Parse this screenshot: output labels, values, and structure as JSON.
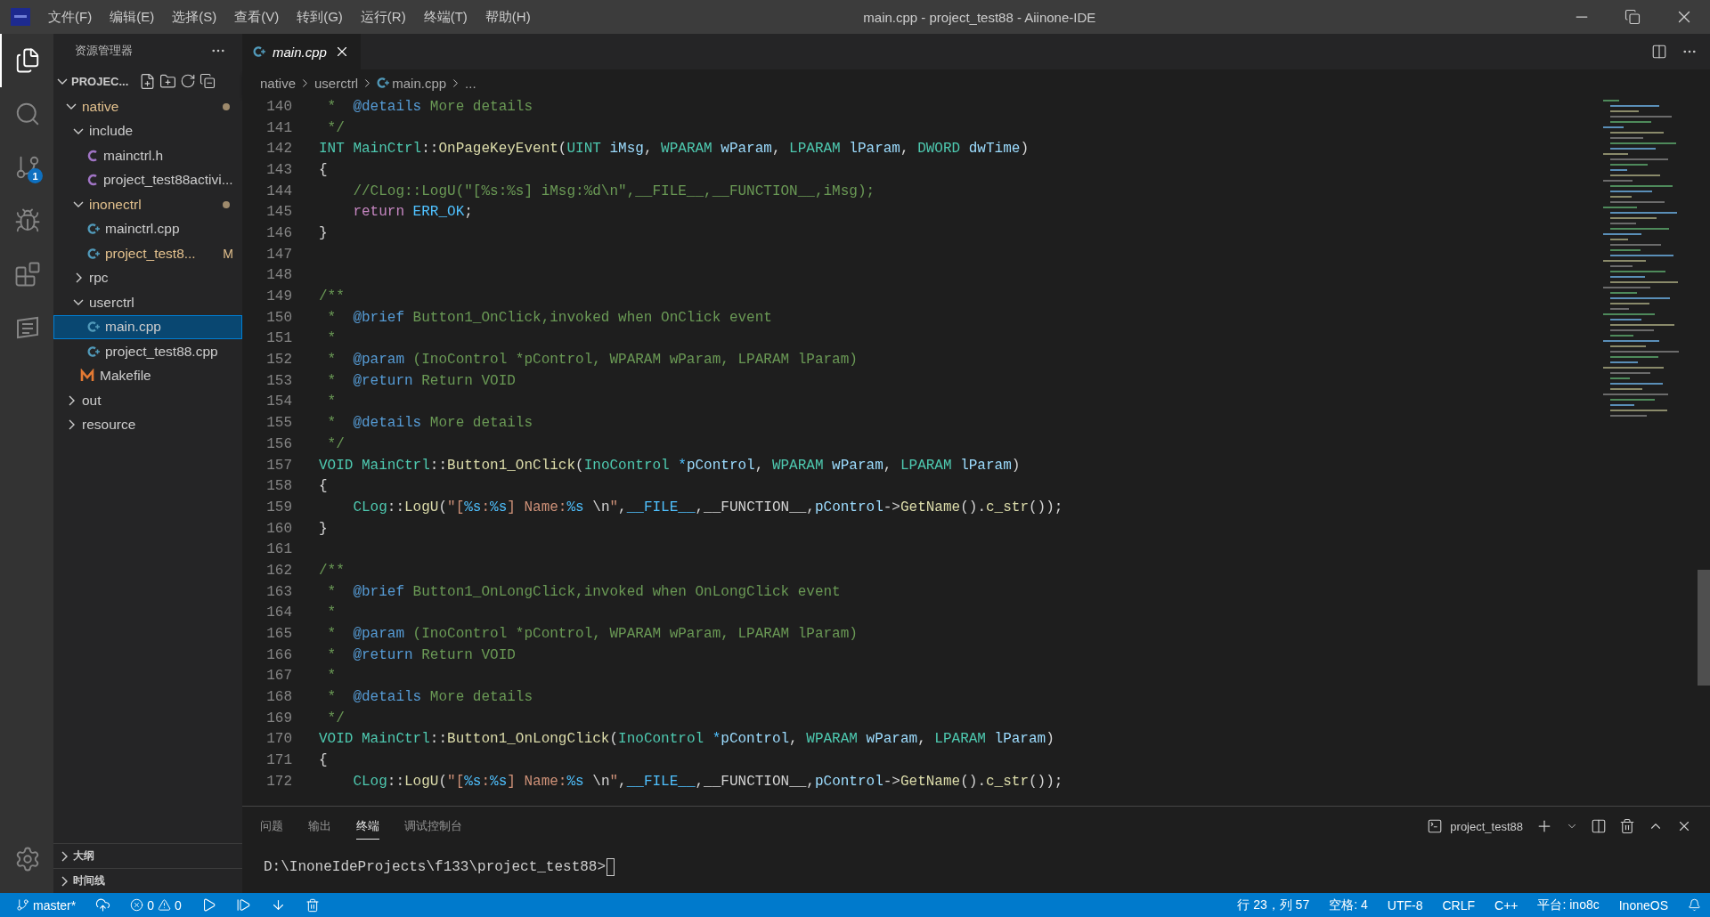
{
  "window": {
    "title": "main.cpp - project_test88 - Aiinone-IDE"
  },
  "menu": [
    "文件(F)",
    "编辑(E)",
    "选择(S)",
    "查看(V)",
    "转到(G)",
    "运行(R)",
    "终端(T)",
    "帮助(H)"
  ],
  "activity_bar": [
    {
      "kind": "explorer",
      "selected": true
    },
    {
      "kind": "search",
      "selected": false
    },
    {
      "kind": "source_control",
      "selected": false,
      "badge": "1"
    },
    {
      "kind": "run",
      "selected": false
    },
    {
      "kind": "extensions",
      "selected": false
    },
    {
      "kind": "logo",
      "selected": false
    }
  ],
  "sidebar": {
    "title": "资源管理器",
    "project": {
      "label": "PROJEC...",
      "expanded": true
    },
    "tree": [
      {
        "label": "native",
        "kind": "folder",
        "expanded": true,
        "modified": true,
        "selected": false,
        "children": [
          {
            "label": "include",
            "kind": "folder",
            "expanded": true,
            "modified": false,
            "selected": false,
            "children": [
              {
                "label": "mainctrl.h",
                "kind": "c",
                "modified": false,
                "selected": false
              },
              {
                "label": "project_test88activi...",
                "kind": "c",
                "modified": false,
                "selected": false
              }
            ]
          },
          {
            "label": "inonectrl",
            "kind": "folder",
            "expanded": true,
            "modified": true,
            "selected": false,
            "children": [
              {
                "label": "mainctrl.cpp",
                "kind": "cpp",
                "modified": false,
                "selected": false
              },
              {
                "label": "project_test8...",
                "kind": "cpp",
                "modified": true,
                "selected": false,
                "badge": "M"
              }
            ]
          },
          {
            "label": "rpc",
            "kind": "folder",
            "expanded": false,
            "modified": false,
            "selected": false
          },
          {
            "label": "userctrl",
            "kind": "folder",
            "expanded": true,
            "modified": false,
            "selected": false,
            "children": [
              {
                "label": "main.cpp",
                "kind": "cpp",
                "modified": false,
                "selected": true
              },
              {
                "label": "project_test88.cpp",
                "kind": "cpp",
                "modified": false,
                "selected": false
              }
            ]
          },
          {
            "label": "Makefile",
            "kind": "makefile",
            "modified": false,
            "selected": false
          }
        ]
      },
      {
        "label": "out",
        "kind": "folder",
        "expanded": false,
        "modified": false,
        "selected": false
      },
      {
        "label": "resource",
        "kind": "folder",
        "expanded": false,
        "modified": false,
        "selected": false
      }
    ],
    "sections": [
      {
        "label": "大纲",
        "expanded": false
      },
      {
        "label": "时间线",
        "expanded": false
      }
    ]
  },
  "editor": {
    "tabs": [
      {
        "label": "main.cpp",
        "selected": true
      }
    ],
    "breadcrumbs": [
      "native",
      "userctrl",
      "main.cpp",
      "..."
    ],
    "lines": [
      {
        "number": "140",
        "tokens": [
          {
            "text": " *  ",
            "kind": "comment"
          },
          {
            "text": "@details",
            "kind": "doctag"
          },
          {
            "text": " More details",
            "kind": "comment"
          }
        ]
      },
      {
        "number": "141",
        "tokens": [
          {
            "text": " */",
            "kind": "comment"
          }
        ]
      },
      {
        "number": "142",
        "tokens": [
          {
            "text": "INT MainCtrl",
            "kind": "type"
          },
          {
            "text": "::",
            "kind": "plain"
          },
          {
            "text": "OnPageKeyEvent",
            "kind": "function"
          },
          {
            "text": "(",
            "kind": "plain"
          },
          {
            "text": "UINT",
            "kind": "type"
          },
          {
            "text": " iMsg",
            "kind": "variable"
          },
          {
            "text": ", ",
            "kind": "plain"
          },
          {
            "text": "WPARAM",
            "kind": "type"
          },
          {
            "text": " wParam",
            "kind": "variable"
          },
          {
            "text": ", ",
            "kind": "plain"
          },
          {
            "text": "LPARAM",
            "kind": "type"
          },
          {
            "text": " lParam",
            "kind": "variable"
          },
          {
            "text": ", ",
            "kind": "plain"
          },
          {
            "text": "DWORD",
            "kind": "type"
          },
          {
            "text": " dwTime",
            "kind": "variable"
          },
          {
            "text": ")",
            "kind": "plain"
          }
        ]
      },
      {
        "number": "143",
        "tokens": [
          {
            "text": "{",
            "kind": "plain"
          }
        ]
      },
      {
        "number": "144",
        "tokens": [
          {
            "text": "    //CLog::LogU(\"[%s:%s] iMsg:%d\\n\",__FILE__,__FUNCTION__,iMsg);",
            "kind": "comment"
          }
        ]
      },
      {
        "number": "145",
        "tokens": [
          {
            "text": "    return",
            "kind": "control"
          },
          {
            "text": " ERR_OK",
            "kind": "constant"
          },
          {
            "text": ";",
            "kind": "plain"
          }
        ]
      },
      {
        "number": "146",
        "tokens": [
          {
            "text": "}",
            "kind": "plain"
          }
        ]
      },
      {
        "number": "147"
      },
      {
        "number": "148"
      },
      {
        "number": "149",
        "tokens": [
          {
            "text": "/**",
            "kind": "comment"
          }
        ]
      },
      {
        "number": "150",
        "tokens": [
          {
            "text": " *  ",
            "kind": "comment"
          },
          {
            "text": "@brief",
            "kind": "doctag"
          },
          {
            "text": " Button1_OnClick,invoked when OnClick event",
            "kind": "comment"
          }
        ]
      },
      {
        "number": "151",
        "tokens": [
          {
            "text": " *",
            "kind": "comment"
          }
        ]
      },
      {
        "number": "152",
        "tokens": [
          {
            "text": " *  ",
            "kind": "comment"
          },
          {
            "text": "@param",
            "kind": "doctag"
          },
          {
            "text": " (InoControl *pControl, WPARAM wParam, LPARAM lParam)",
            "kind": "comment"
          }
        ]
      },
      {
        "number": "153",
        "tokens": [
          {
            "text": " *  ",
            "kind": "comment"
          },
          {
            "text": "@return",
            "kind": "doctag"
          },
          {
            "text": " Return VOID",
            "kind": "comment"
          }
        ]
      },
      {
        "number": "154",
        "tokens": [
          {
            "text": " *",
            "kind": "comment"
          }
        ]
      },
      {
        "number": "155",
        "tokens": [
          {
            "text": " *  ",
            "kind": "comment"
          },
          {
            "text": "@details",
            "kind": "doctag"
          },
          {
            "text": " More details",
            "kind": "comment"
          }
        ]
      },
      {
        "number": "156",
        "tokens": [
          {
            "text": " */",
            "kind": "comment"
          }
        ]
      },
      {
        "number": "157",
        "tokens": [
          {
            "text": "VOID MainCtrl",
            "kind": "type"
          },
          {
            "text": "::",
            "kind": "plain"
          },
          {
            "text": "Button1_OnClick",
            "kind": "function"
          },
          {
            "text": "(",
            "kind": "plain"
          },
          {
            "text": "InoControl",
            "kind": "type"
          },
          {
            "text": " *",
            "kind": "constant"
          },
          {
            "text": "pControl",
            "kind": "variable"
          },
          {
            "text": ", ",
            "kind": "plain"
          },
          {
            "text": "WPARAM",
            "kind": "type"
          },
          {
            "text": " wParam",
            "kind": "variable"
          },
          {
            "text": ", ",
            "kind": "plain"
          },
          {
            "text": "LPARAM",
            "kind": "type"
          },
          {
            "text": " lParam",
            "kind": "variable"
          },
          {
            "text": ")",
            "kind": "plain"
          }
        ]
      },
      {
        "number": "158",
        "tokens": [
          {
            "text": "{",
            "kind": "plain"
          }
        ]
      },
      {
        "number": "159",
        "tokens": [
          {
            "text": "    CLog",
            "kind": "type"
          },
          {
            "text": "::",
            "kind": "plain"
          },
          {
            "text": "LogU",
            "kind": "function"
          },
          {
            "text": "(",
            "kind": "plain"
          },
          {
            "text": "\"[",
            "kind": "string"
          },
          {
            "text": "%s",
            "kind": "constant"
          },
          {
            "text": ":",
            "kind": "string"
          },
          {
            "text": "%s",
            "kind": "constant"
          },
          {
            "text": "] Name:",
            "kind": "string"
          },
          {
            "text": "%s",
            "kind": "constant"
          },
          {
            "text": " \\n",
            "kind": "plain"
          },
          {
            "text": "\"",
            "kind": "string"
          },
          {
            "text": ",",
            "kind": "plain"
          },
          {
            "text": "__FILE__",
            "kind": "constant"
          },
          {
            "text": ",__FUNCTION__,",
            "kind": "plain"
          },
          {
            "text": "pControl",
            "kind": "variable"
          },
          {
            "text": "->",
            "kind": "plain"
          },
          {
            "text": "GetName",
            "kind": "function"
          },
          {
            "text": "().",
            "kind": "plain"
          },
          {
            "text": "c_str",
            "kind": "function"
          },
          {
            "text": "());",
            "kind": "plain"
          }
        ]
      },
      {
        "number": "160",
        "tokens": [
          {
            "text": "}",
            "kind": "plain"
          }
        ]
      },
      {
        "number": "161"
      },
      {
        "number": "162",
        "tokens": [
          {
            "text": "/**",
            "kind": "comment"
          }
        ]
      },
      {
        "number": "163",
        "tokens": [
          {
            "text": " *  ",
            "kind": "comment"
          },
          {
            "text": "@brief",
            "kind": "doctag"
          },
          {
            "text": " Button1_OnLongClick,invoked when OnLongClick event",
            "kind": "comment"
          }
        ]
      },
      {
        "number": "164",
        "tokens": [
          {
            "text": " *",
            "kind": "comment"
          }
        ]
      },
      {
        "number": "165",
        "tokens": [
          {
            "text": " *  ",
            "kind": "comment"
          },
          {
            "text": "@param",
            "kind": "doctag"
          },
          {
            "text": " (InoControl *pControl, WPARAM wParam, LPARAM lParam)",
            "kind": "comment"
          }
        ]
      },
      {
        "number": "166",
        "tokens": [
          {
            "text": " *  ",
            "kind": "comment"
          },
          {
            "text": "@return",
            "kind": "doctag"
          },
          {
            "text": " Return VOID",
            "kind": "comment"
          }
        ]
      },
      {
        "number": "167",
        "tokens": [
          {
            "text": " *",
            "kind": "comment"
          }
        ]
      },
      {
        "number": "168",
        "tokens": [
          {
            "text": " *  ",
            "kind": "comment"
          },
          {
            "text": "@details",
            "kind": "doctag"
          },
          {
            "text": " More details",
            "kind": "comment"
          }
        ]
      },
      {
        "number": "169",
        "tokens": [
          {
            "text": " */",
            "kind": "comment"
          }
        ]
      },
      {
        "number": "170",
        "tokens": [
          {
            "text": "VOID MainCtrl",
            "kind": "type"
          },
          {
            "text": "::",
            "kind": "plain"
          },
          {
            "text": "Button1_OnLongClick",
            "kind": "function"
          },
          {
            "text": "(",
            "kind": "plain"
          },
          {
            "text": "InoControl",
            "kind": "type"
          },
          {
            "text": " *",
            "kind": "constant"
          },
          {
            "text": "pControl",
            "kind": "variable"
          },
          {
            "text": ", ",
            "kind": "plain"
          },
          {
            "text": "WPARAM",
            "kind": "type"
          },
          {
            "text": " wParam",
            "kind": "variable"
          },
          {
            "text": ", ",
            "kind": "plain"
          },
          {
            "text": "LPARAM",
            "kind": "type"
          },
          {
            "text": " lParam",
            "kind": "variable"
          },
          {
            "text": ")",
            "kind": "plain"
          }
        ]
      },
      {
        "number": "171",
        "tokens": [
          {
            "text": "{",
            "kind": "plain"
          }
        ]
      },
      {
        "number": "172",
        "tokens": [
          {
            "text": "    CLog",
            "kind": "type"
          },
          {
            "text": "::",
            "kind": "plain"
          },
          {
            "text": "LogU",
            "kind": "function"
          },
          {
            "text": "(",
            "kind": "plain"
          },
          {
            "text": "\"[",
            "kind": "string"
          },
          {
            "text": "%s",
            "kind": "constant"
          },
          {
            "text": ":",
            "kind": "string"
          },
          {
            "text": "%s",
            "kind": "constant"
          },
          {
            "text": "] Name:",
            "kind": "string"
          },
          {
            "text": "%s",
            "kind": "constant"
          },
          {
            "text": " \\n",
            "kind": "plain"
          },
          {
            "text": "\"",
            "kind": "string"
          },
          {
            "text": ",",
            "kind": "plain"
          },
          {
            "text": "__FILE__",
            "kind": "constant"
          },
          {
            "text": ",__FUNCTION__,",
            "kind": "plain"
          },
          {
            "text": "pControl",
            "kind": "variable"
          },
          {
            "text": "->",
            "kind": "plain"
          },
          {
            "text": "GetName",
            "kind": "function"
          },
          {
            "text": "().",
            "kind": "plain"
          },
          {
            "text": "c_str",
            "kind": "function"
          },
          {
            "text": "());",
            "kind": "plain"
          }
        ]
      }
    ]
  },
  "panel": {
    "tabs": [
      {
        "label": "问题",
        "selected": false
      },
      {
        "label": "输出",
        "selected": false
      },
      {
        "label": "终端",
        "selected": true
      },
      {
        "label": "调试控制台",
        "selected": false
      }
    ],
    "terminal_name": "project_test88",
    "prompt": "D:\\InoneIdeProjects\\f133\\project_test88>"
  },
  "status_bar": {
    "branch": "master*",
    "errors": "0",
    "warnings": "0",
    "right": [
      "行 23，列 57",
      "空格: 4",
      "UTF-8",
      "CRLF",
      "C++",
      "平台: ino8c",
      "InoneOS"
    ]
  }
}
